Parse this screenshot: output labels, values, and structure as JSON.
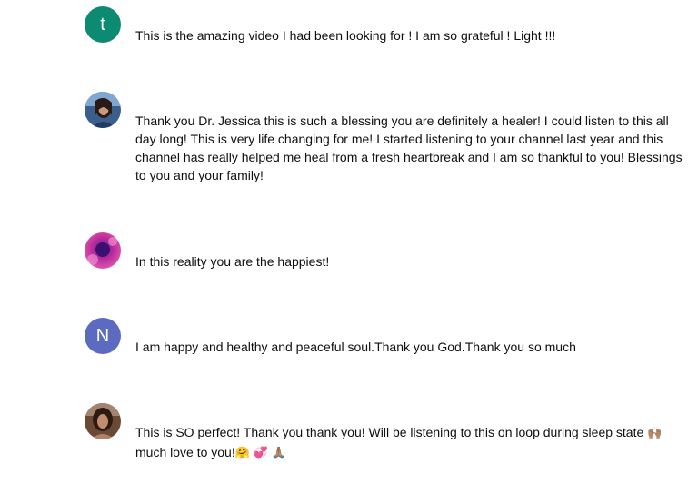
{
  "comments": [
    {
      "avatar_letter": "t",
      "avatar_color": "#0d8a72",
      "text": "This is the amazing video I had been looking for !  I am so grateful !  Light !!!"
    },
    {
      "avatar_kind": "photo",
      "text": "Thank you Dr. Jessica this is such a blessing you are definitely a healer! I could listen to this all day long! This is very life changing for me! I started listening to your channel last year and this channel has really helped me heal from a fresh heartbreak and I am so thankful to you! Blessings to you and your family!"
    },
    {
      "avatar_kind": "photo",
      "text": "In this reality you are the happiest!"
    },
    {
      "avatar_letter": "N",
      "avatar_color": "#5c6bc0",
      "text": "I am happy and healthy and peaceful soul.Thank you God.Thank you so much"
    },
    {
      "avatar_kind": "photo",
      "text_before_emoji": "This is SO perfect! Thank you thank you! Will be listening to this on loop during sleep state",
      "emoji_1": "🙌🏽",
      "text_line2": "much love to you!",
      "emoji_2": "🤗",
      "emoji_3": "💞",
      "emoji_4": "🙏🏽"
    }
  ]
}
